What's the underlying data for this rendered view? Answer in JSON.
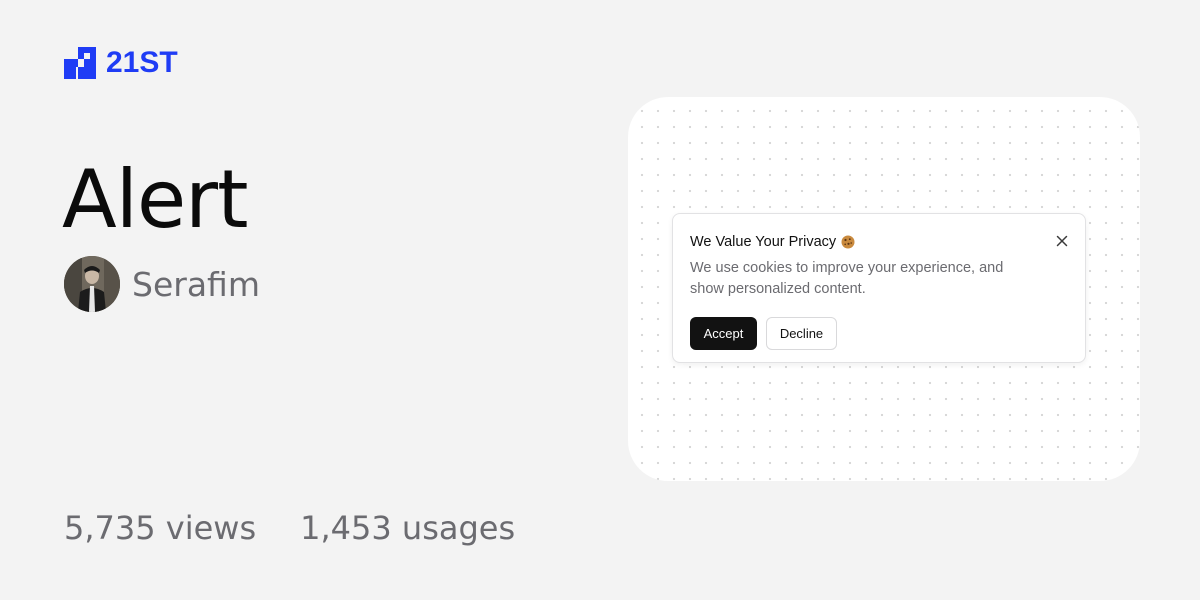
{
  "brand": {
    "name": "21ST",
    "color": "#1f3cf5",
    "icon": "logo-mark-icon"
  },
  "component": {
    "title": "Alert"
  },
  "author": {
    "name": "Serafim",
    "avatar": "avatar-photo"
  },
  "stats": {
    "views": "5,735 views",
    "usages": "1,453 usages"
  },
  "preview": {
    "alert": {
      "title": "We Value Your Privacy",
      "title_icon": "cookie-icon",
      "description": "We use cookies to improve your experience, and show personalized content.",
      "close_icon": "close-icon",
      "accept_label": "Accept",
      "decline_label": "Decline"
    }
  },
  "colors": {
    "background": "#f3f3f3",
    "muted_text": "#6b6b70",
    "accept_bg": "#121212"
  }
}
